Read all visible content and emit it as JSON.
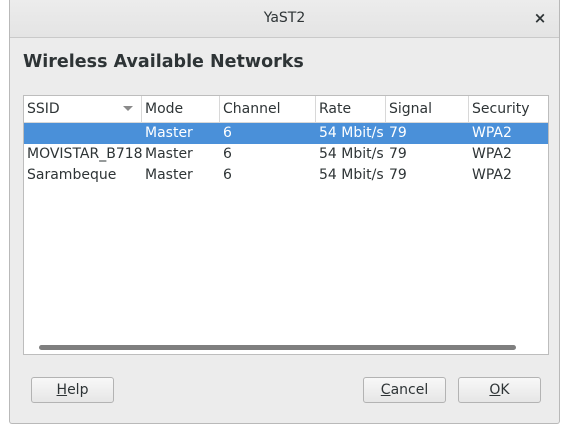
{
  "window": {
    "title": "YaST2",
    "close_glyph": "×",
    "heading": "Wireless Available Networks"
  },
  "table": {
    "columns": [
      "SSID",
      "Mode",
      "Channel",
      "Rate",
      "Signal",
      "Security"
    ],
    "sort_column": "SSID",
    "rows": [
      {
        "ssid": "",
        "mode": "Master",
        "channel": "6",
        "rate": "54 Mbit/s",
        "signal": "79",
        "security": "WPA2",
        "selected": true
      },
      {
        "ssid": "MOVISTAR_B718",
        "mode": "Master",
        "channel": "6",
        "rate": "54 Mbit/s",
        "signal": "79",
        "security": "WPA2",
        "selected": false
      },
      {
        "ssid": "Sarambeque",
        "mode": "Master",
        "channel": "6",
        "rate": "54 Mbit/s",
        "signal": "79",
        "security": "WPA2",
        "selected": false
      }
    ]
  },
  "buttons": {
    "help": {
      "mnemonic": "H",
      "rest": "elp"
    },
    "cancel": {
      "mnemonic": "C",
      "rest": "ancel"
    },
    "ok": {
      "mnemonic": "O",
      "rest": "K"
    }
  },
  "colors": {
    "selection": "#4a90d9",
    "text": "#2e3436"
  },
  "icons": {
    "close": "close-icon",
    "sort": "sort-descending-icon"
  }
}
